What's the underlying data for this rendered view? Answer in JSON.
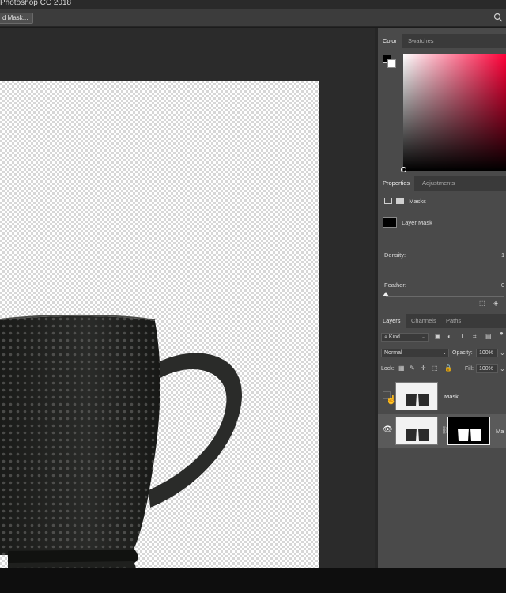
{
  "app": {
    "title": "Photoshop CC 2018"
  },
  "options": {
    "select_mask_label": "d Mask..."
  },
  "color_panel": {
    "tabs": [
      "Color",
      "Swatches"
    ],
    "accent": "#ff0038"
  },
  "properties_panel": {
    "tabs": [
      "Properties",
      "Adjustments"
    ],
    "heading": "Masks",
    "mask_type": "Layer Mask",
    "density_label": "Density:",
    "density_value": "1",
    "feather_label": "Feather:",
    "feather_value": "0"
  },
  "layers_panel": {
    "tabs": [
      "Layers",
      "Channels",
      "Paths"
    ],
    "filter_kind": "Kind",
    "blend_mode": "Normal",
    "opacity_label": "Opacity:",
    "opacity_value": "100%",
    "lock_label": "Lock:",
    "fill_label": "Fill:",
    "fill_value": "100%",
    "layers": [
      {
        "name": "Mask"
      },
      {
        "name": "Ma"
      }
    ],
    "footer_icons": [
      "link-icon",
      "fx-icon",
      "mask-icon",
      "adjustment-icon",
      "folder-icon"
    ]
  }
}
